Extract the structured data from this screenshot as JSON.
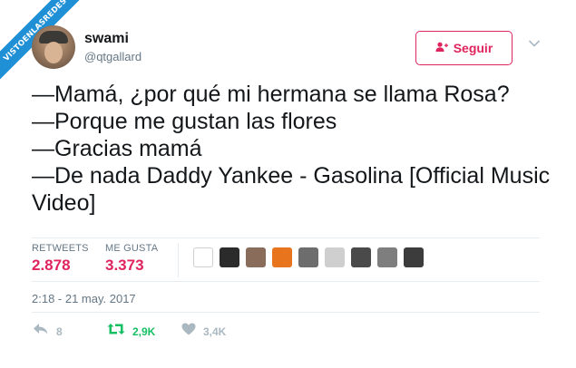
{
  "watermark": "VISTOENLASREDES",
  "user": {
    "name": "swami",
    "handle": "@qtgallard"
  },
  "follow_button": {
    "label": "Seguir",
    "icon": "user-plus-icon"
  },
  "menu_icon": "chevron-down-icon",
  "tweet": {
    "lines": [
      "—Mamá, ¿por qué mi hermana se llama Rosa?",
      "—Porque me gustan las flores",
      "—Gracias mamá",
      "—De nada Daddy Yankee - Gasolina [Official Music Video]"
    ]
  },
  "stats": {
    "retweets_label": "RETWEETS",
    "retweets_value": "2.878",
    "likes_label": "ME GUSTA",
    "likes_value": "3.373"
  },
  "liker_avatar_colors": [
    "#ffffff",
    "#2b2b2b",
    "#8a6c5a",
    "#e8741e",
    "#6d6d6d",
    "#cfcfcf",
    "#4a4a4a",
    "#7e7e7e",
    "#3c3c3c"
  ],
  "timestamp": "2:18 - 21 may. 2017",
  "actions": {
    "reply_count": "8",
    "retweet_count": "2,9K",
    "like_count": "3,4K"
  },
  "colors": {
    "accent": "#e0245e",
    "retweet": "#17bf63",
    "muted": "#657786",
    "ribbon": "#1f8fd6"
  }
}
